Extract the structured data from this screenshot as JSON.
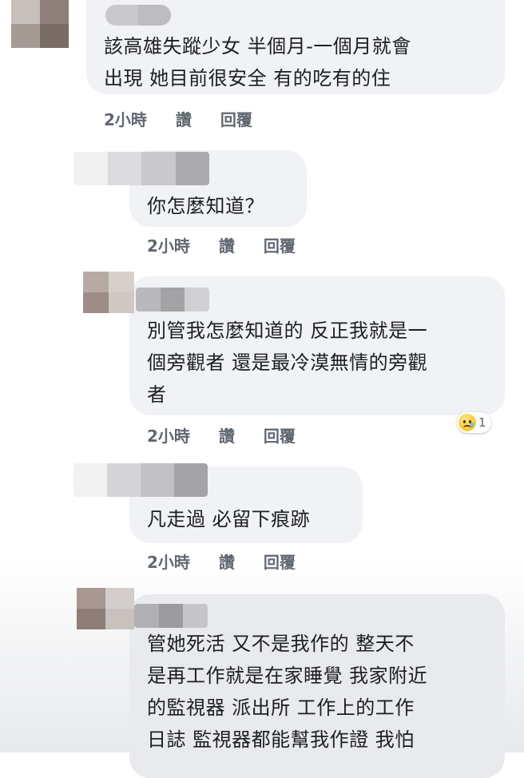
{
  "comments": [
    {
      "text": "該高雄失蹤少女 半個月-一個月就會\n出現 她目前很安全 有的吃有的住",
      "time": "2小時",
      "like": "讚",
      "reply": "回覆"
    },
    {
      "text": "你怎麼知道？",
      "time": "2小時",
      "like": "讚",
      "reply": "回覆"
    },
    {
      "text": "別管我怎麼知道的 反正我就是一\n個旁觀者 還是最冷漠無情的旁觀\n者",
      "time": "2小時",
      "like": "讚",
      "reply": "回覆",
      "reaction": {
        "icon": "sad-emoji-icon",
        "count": "1"
      }
    },
    {
      "text": "凡走過 必留下痕跡",
      "time": "2小時",
      "like": "讚",
      "reply": "回覆"
    },
    {
      "text": "管她死活 又不是我作的 整天不\n是再工作就是在家睡覺 我家附近\n的監視器 派出所 工作上的工作\n日誌 監視器都能幫我作證 我怕"
    }
  ],
  "colors": {
    "bubble": "#f0f2f5",
    "meta": "#606770",
    "text": "#1c1e21"
  }
}
